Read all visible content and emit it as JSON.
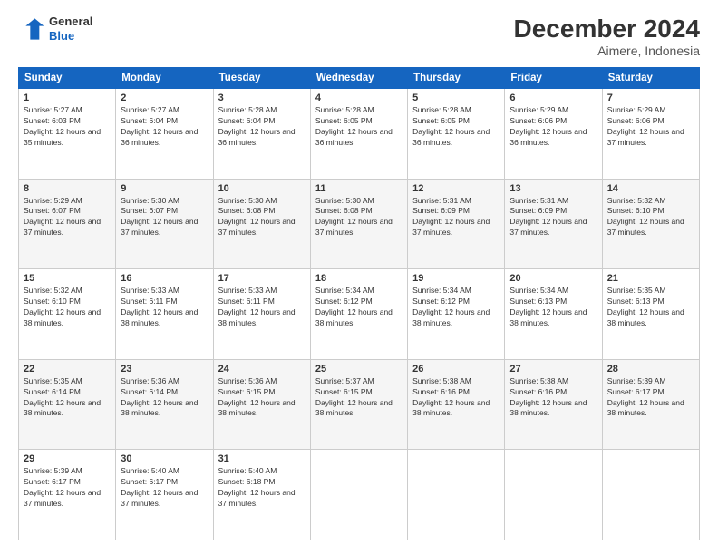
{
  "logo": {
    "line1": "General",
    "line2": "Blue"
  },
  "title": "December 2024",
  "subtitle": "Aimere, Indonesia",
  "days_header": [
    "Sunday",
    "Monday",
    "Tuesday",
    "Wednesday",
    "Thursday",
    "Friday",
    "Saturday"
  ],
  "weeks": [
    [
      {
        "day": "1",
        "sunrise": "5:27 AM",
        "sunset": "6:03 PM",
        "daylight": "12 hours and 35 minutes."
      },
      {
        "day": "2",
        "sunrise": "5:27 AM",
        "sunset": "6:04 PM",
        "daylight": "12 hours and 36 minutes."
      },
      {
        "day": "3",
        "sunrise": "5:28 AM",
        "sunset": "6:04 PM",
        "daylight": "12 hours and 36 minutes."
      },
      {
        "day": "4",
        "sunrise": "5:28 AM",
        "sunset": "6:05 PM",
        "daylight": "12 hours and 36 minutes."
      },
      {
        "day": "5",
        "sunrise": "5:28 AM",
        "sunset": "6:05 PM",
        "daylight": "12 hours and 36 minutes."
      },
      {
        "day": "6",
        "sunrise": "5:29 AM",
        "sunset": "6:06 PM",
        "daylight": "12 hours and 36 minutes."
      },
      {
        "day": "7",
        "sunrise": "5:29 AM",
        "sunset": "6:06 PM",
        "daylight": "12 hours and 37 minutes."
      }
    ],
    [
      {
        "day": "8",
        "sunrise": "5:29 AM",
        "sunset": "6:07 PM",
        "daylight": "12 hours and 37 minutes."
      },
      {
        "day": "9",
        "sunrise": "5:30 AM",
        "sunset": "6:07 PM",
        "daylight": "12 hours and 37 minutes."
      },
      {
        "day": "10",
        "sunrise": "5:30 AM",
        "sunset": "6:08 PM",
        "daylight": "12 hours and 37 minutes."
      },
      {
        "day": "11",
        "sunrise": "5:30 AM",
        "sunset": "6:08 PM",
        "daylight": "12 hours and 37 minutes."
      },
      {
        "day": "12",
        "sunrise": "5:31 AM",
        "sunset": "6:09 PM",
        "daylight": "12 hours and 37 minutes."
      },
      {
        "day": "13",
        "sunrise": "5:31 AM",
        "sunset": "6:09 PM",
        "daylight": "12 hours and 37 minutes."
      },
      {
        "day": "14",
        "sunrise": "5:32 AM",
        "sunset": "6:10 PM",
        "daylight": "12 hours and 37 minutes."
      }
    ],
    [
      {
        "day": "15",
        "sunrise": "5:32 AM",
        "sunset": "6:10 PM",
        "daylight": "12 hours and 38 minutes."
      },
      {
        "day": "16",
        "sunrise": "5:33 AM",
        "sunset": "6:11 PM",
        "daylight": "12 hours and 38 minutes."
      },
      {
        "day": "17",
        "sunrise": "5:33 AM",
        "sunset": "6:11 PM",
        "daylight": "12 hours and 38 minutes."
      },
      {
        "day": "18",
        "sunrise": "5:34 AM",
        "sunset": "6:12 PM",
        "daylight": "12 hours and 38 minutes."
      },
      {
        "day": "19",
        "sunrise": "5:34 AM",
        "sunset": "6:12 PM",
        "daylight": "12 hours and 38 minutes."
      },
      {
        "day": "20",
        "sunrise": "5:34 AM",
        "sunset": "6:13 PM",
        "daylight": "12 hours and 38 minutes."
      },
      {
        "day": "21",
        "sunrise": "5:35 AM",
        "sunset": "6:13 PM",
        "daylight": "12 hours and 38 minutes."
      }
    ],
    [
      {
        "day": "22",
        "sunrise": "5:35 AM",
        "sunset": "6:14 PM",
        "daylight": "12 hours and 38 minutes."
      },
      {
        "day": "23",
        "sunrise": "5:36 AM",
        "sunset": "6:14 PM",
        "daylight": "12 hours and 38 minutes."
      },
      {
        "day": "24",
        "sunrise": "5:36 AM",
        "sunset": "6:15 PM",
        "daylight": "12 hours and 38 minutes."
      },
      {
        "day": "25",
        "sunrise": "5:37 AM",
        "sunset": "6:15 PM",
        "daylight": "12 hours and 38 minutes."
      },
      {
        "day": "26",
        "sunrise": "5:38 AM",
        "sunset": "6:16 PM",
        "daylight": "12 hours and 38 minutes."
      },
      {
        "day": "27",
        "sunrise": "5:38 AM",
        "sunset": "6:16 PM",
        "daylight": "12 hours and 38 minutes."
      },
      {
        "day": "28",
        "sunrise": "5:39 AM",
        "sunset": "6:17 PM",
        "daylight": "12 hours and 38 minutes."
      }
    ],
    [
      {
        "day": "29",
        "sunrise": "5:39 AM",
        "sunset": "6:17 PM",
        "daylight": "12 hours and 37 minutes."
      },
      {
        "day": "30",
        "sunrise": "5:40 AM",
        "sunset": "6:17 PM",
        "daylight": "12 hours and 37 minutes."
      },
      {
        "day": "31",
        "sunrise": "5:40 AM",
        "sunset": "6:18 PM",
        "daylight": "12 hours and 37 minutes."
      },
      null,
      null,
      null,
      null
    ]
  ],
  "labels": {
    "sunrise": "Sunrise: ",
    "sunset": "Sunset: ",
    "daylight": "Daylight: "
  }
}
